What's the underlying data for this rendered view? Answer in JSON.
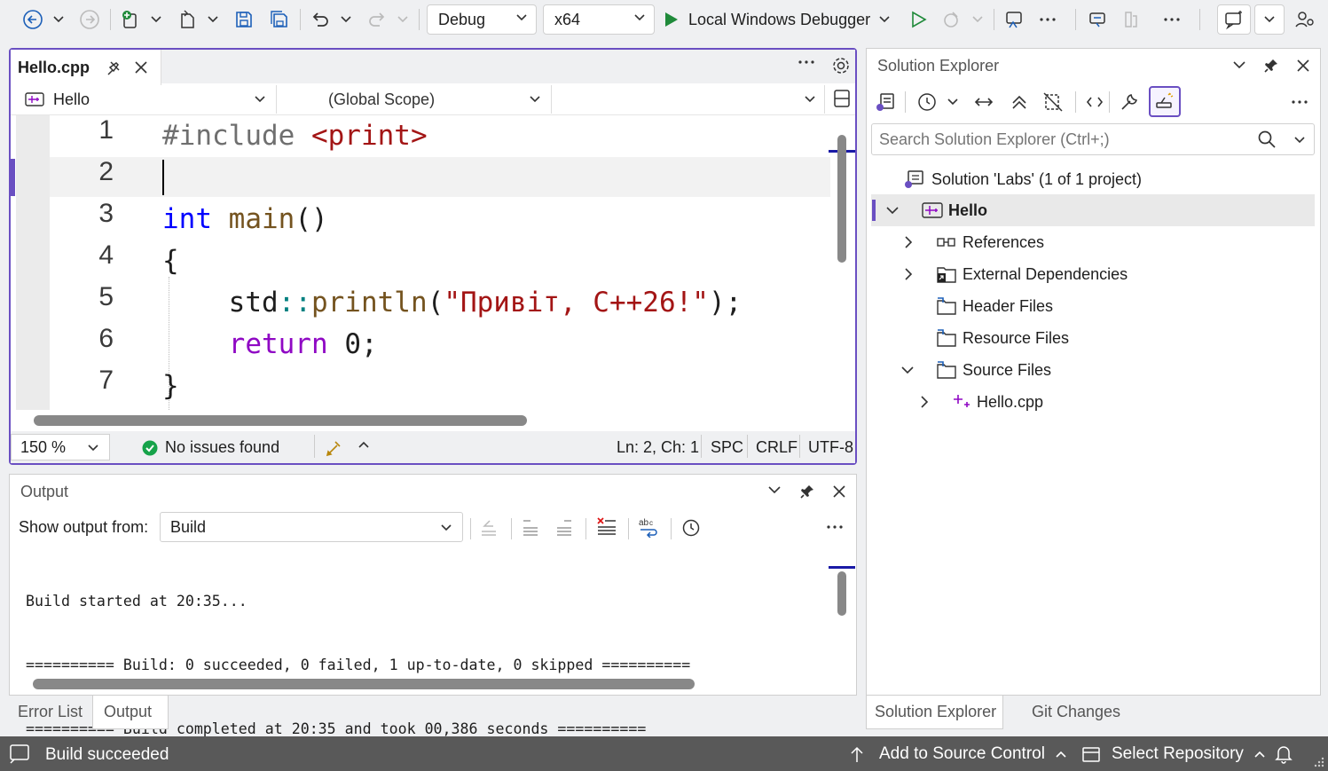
{
  "toolbar": {
    "config": "Debug",
    "platform": "x64",
    "debugger": "Local Windows Debugger"
  },
  "editor": {
    "tab": "Hello.cpp",
    "project_combo": "Hello",
    "scope_combo": "(Global Scope)",
    "member_combo": "",
    "line_numbers": [
      "1",
      "2",
      "3",
      "4",
      "5",
      "6",
      "7"
    ],
    "lines": {
      "l1_a": "#include",
      "l1_b": "<print>",
      "l3_a": "int",
      "l3_b": "main",
      "l3_c": "()",
      "l4": "{",
      "l5_a": "std",
      "l5_b": "::",
      "l5_c": "println",
      "l5_d": "(",
      "l5_e": "\"Привіт, C++26!\"",
      "l5_f": ");",
      "l6_a": "return",
      "l6_b": "0;",
      "l7": "}"
    },
    "zoom": "150 %",
    "issues": "No issues found",
    "position": "Ln: 2, Ch: 1",
    "whitespace": "SPC",
    "line_ending": "CRLF",
    "encoding": "UTF-8"
  },
  "output": {
    "title": "Output",
    "show_from_label": "Show output from:",
    "source": "Build",
    "lines": [
      "Build started at 20:35...",
      "========== Build: 0 succeeded, 0 failed, 1 up-to-date, 0 skipped ==========",
      "========== Build completed at 20:35 and took 00,386 seconds =========="
    ]
  },
  "bottom_tabs": [
    "Error List",
    "Output"
  ],
  "solution_explorer": {
    "title": "Solution Explorer",
    "search_placeholder": "Search Solution Explorer (Ctrl+;)",
    "tree": {
      "solution": "Solution 'Labs' (1 of 1 project)",
      "project": "Hello",
      "references": "References",
      "external": "External Dependencies",
      "headers": "Header Files",
      "resources": "Resource Files",
      "sources": "Source Files",
      "file": "Hello.cpp"
    },
    "tabs": [
      "Solution Explorer",
      "Git Changes"
    ]
  },
  "statusbar": {
    "message": "Build succeeded",
    "source_control": "Add to Source Control",
    "repository": "Select Repository"
  },
  "colors": {
    "accent": "#6a4fc2",
    "keyword": "#0000ff",
    "string": "#a31515",
    "control": "#8f08c4",
    "function": "#74531f",
    "success": "#16a34a"
  }
}
